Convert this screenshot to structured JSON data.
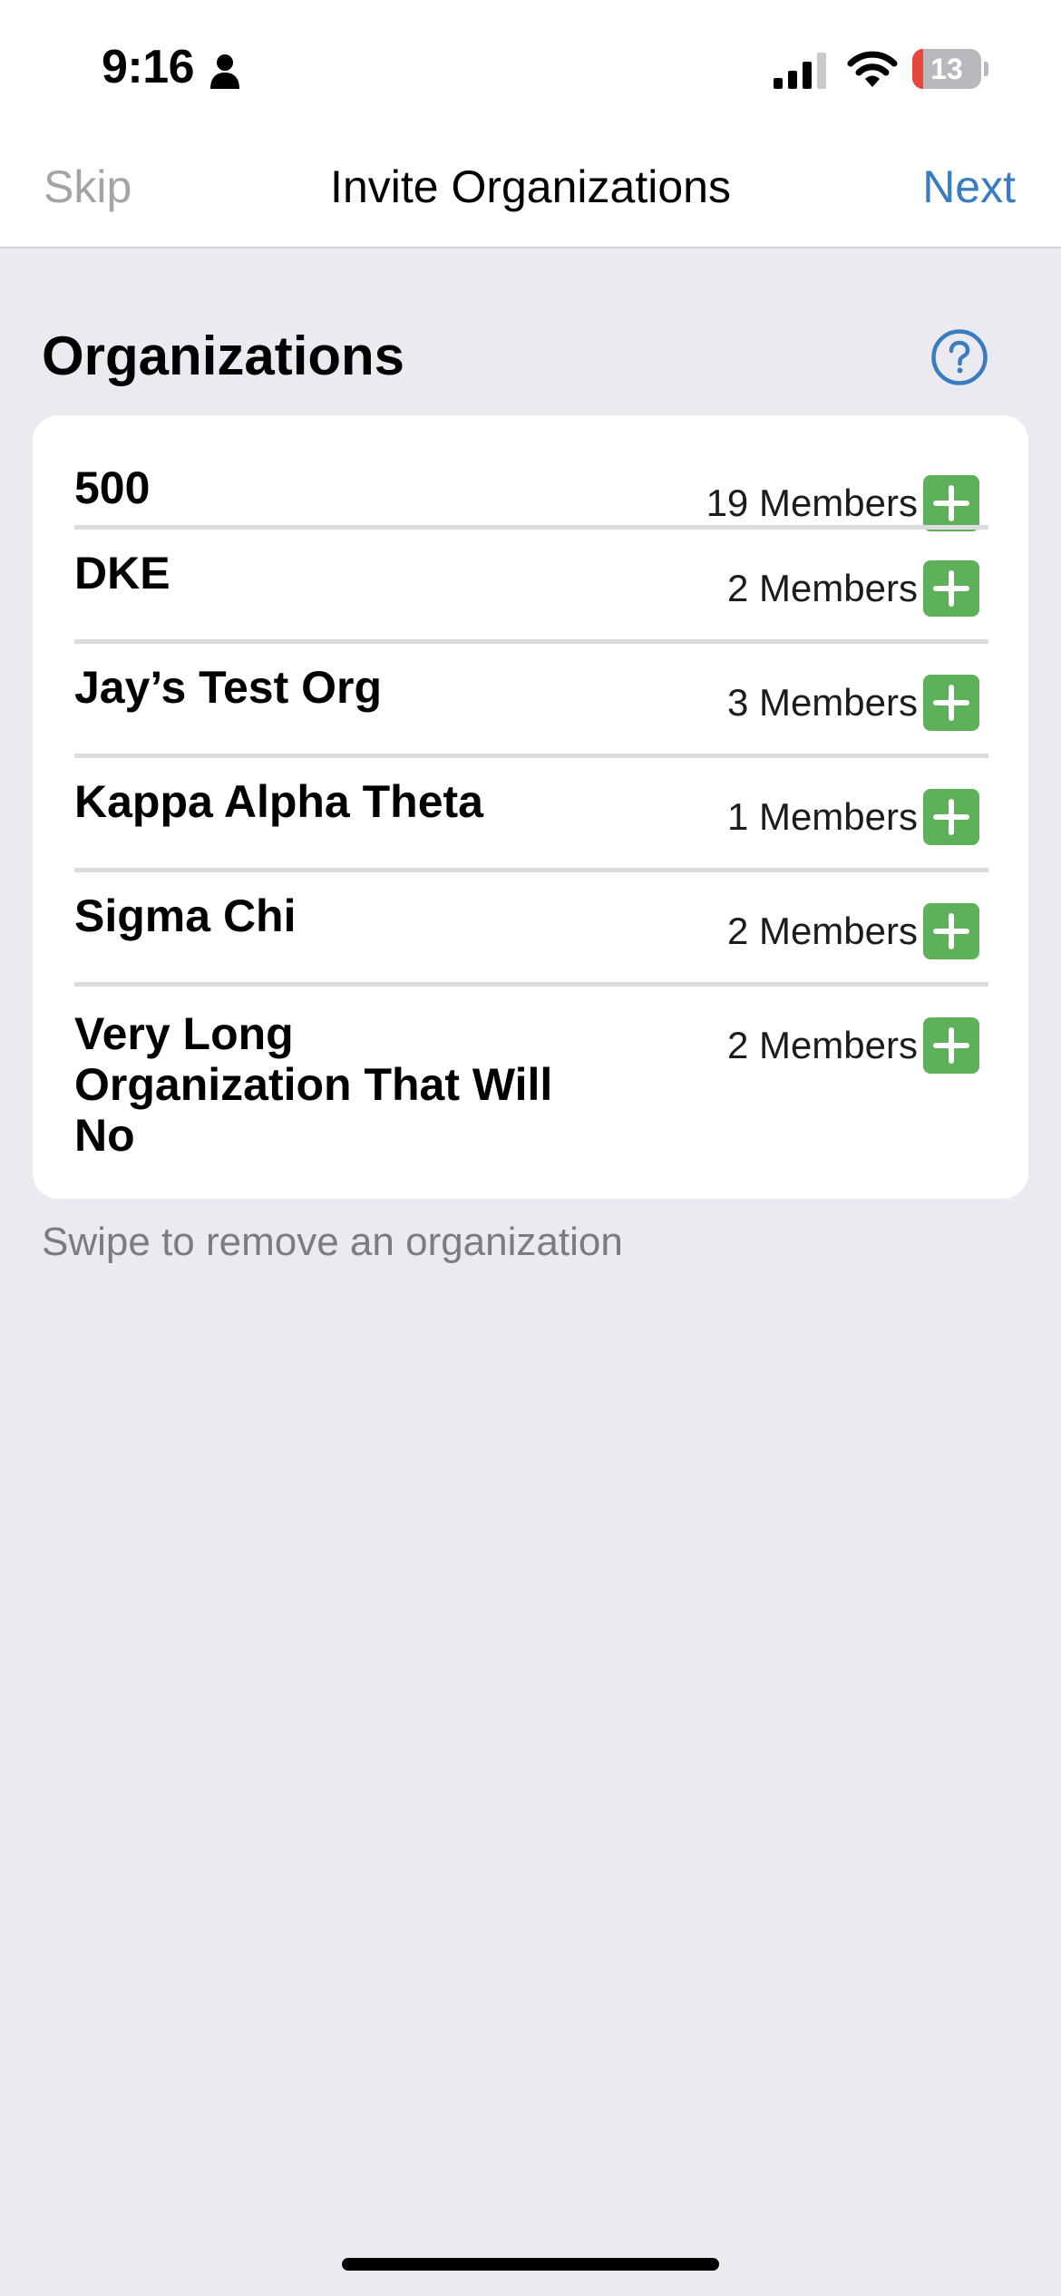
{
  "status_bar": {
    "time": "9:16",
    "battery_level": "13",
    "icons": [
      "person-icon",
      "signal-icon",
      "wifi-icon",
      "battery-icon"
    ]
  },
  "nav": {
    "skip_label": "Skip",
    "title": "Invite Organizations",
    "next_label": "Next"
  },
  "section": {
    "title": "Organizations",
    "help_icon": "question-circle-icon"
  },
  "organizations": [
    {
      "name": "500",
      "members": "19 Members"
    },
    {
      "name": "DKE",
      "members": "2 Members"
    },
    {
      "name": "Jay’s Test Org",
      "members": "3 Members"
    },
    {
      "name": "Kappa Alpha Theta",
      "members": "1 Members"
    },
    {
      "name": "Sigma Chi",
      "members": "2 Members"
    },
    {
      "name": "Very Long Organization That Will No",
      "members": "2 Members"
    }
  ],
  "footer_hint": "Swipe to remove an organization",
  "colors": {
    "accent": "#3a7cc0",
    "add_button": "#5fb05b",
    "background": "#ebeaf0",
    "muted": "#a3a3a8"
  }
}
